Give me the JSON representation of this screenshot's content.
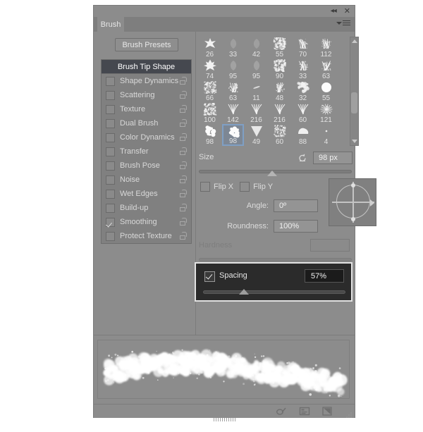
{
  "window": {
    "title": "Brush",
    "collapse_icon": "collapse-left-icon",
    "close_icon": "close-icon",
    "menu_icon": "panel-menu-icon"
  },
  "left_panel": {
    "presets_button": "Brush Presets",
    "header": "Brush Tip Shape",
    "options": [
      {
        "label": "Shape Dynamics",
        "checked": false,
        "lock": true
      },
      {
        "label": "Scattering",
        "checked": false,
        "lock": true
      },
      {
        "label": "Texture",
        "checked": false,
        "lock": true
      },
      {
        "label": "Dual Brush",
        "checked": false,
        "lock": true
      },
      {
        "label": "Color Dynamics",
        "checked": false,
        "lock": true
      },
      {
        "label": "Transfer",
        "checked": false,
        "lock": true
      },
      {
        "label": "Brush Pose",
        "checked": false,
        "lock": true
      },
      {
        "label": "Noise",
        "checked": false,
        "lock": true
      },
      {
        "label": "Wet Edges",
        "checked": false,
        "lock": true
      },
      {
        "label": "Build-up",
        "checked": false,
        "lock": true
      },
      {
        "label": "Smoothing",
        "checked": true,
        "lock": true
      },
      {
        "label": "Protect Texture",
        "checked": false,
        "lock": true
      }
    ]
  },
  "brush_grid": {
    "selected_index": 25,
    "tips": [
      {
        "size": "26",
        "shape": "star"
      },
      {
        "size": "33",
        "shape": "leaf"
      },
      {
        "size": "42",
        "shape": "leaf"
      },
      {
        "size": "55",
        "shape": "scatter"
      },
      {
        "size": "70",
        "shape": "grass"
      },
      {
        "size": "112",
        "shape": "grass"
      },
      {
        "size": "74",
        "shape": "maple"
      },
      {
        "size": "95",
        "shape": "leaf-solid"
      },
      {
        "size": "95",
        "shape": "leaf-solid"
      },
      {
        "size": "90",
        "shape": "scatter"
      },
      {
        "size": "33",
        "shape": "grass"
      },
      {
        "size": "63",
        "shape": "grass"
      },
      {
        "size": "66",
        "shape": "speckle"
      },
      {
        "size": "63",
        "shape": "grass"
      },
      {
        "size": "11",
        "shape": "dash"
      },
      {
        "size": "48",
        "shape": "grass"
      },
      {
        "size": "32",
        "shape": "splat"
      },
      {
        "size": "55",
        "shape": "round"
      },
      {
        "size": "100",
        "shape": "speckle"
      },
      {
        "size": "142",
        "shape": "blades"
      },
      {
        "size": "216",
        "shape": "blades"
      },
      {
        "size": "216",
        "shape": "blades"
      },
      {
        "size": "60",
        "shape": "blades"
      },
      {
        "size": "121",
        "shape": "burst"
      },
      {
        "size": "98",
        "shape": "cloud"
      },
      {
        "size": "98",
        "shape": "cloud"
      },
      {
        "size": "49",
        "shape": "cone"
      },
      {
        "size": "60",
        "shape": "noise"
      },
      {
        "size": "88",
        "shape": "blob"
      },
      {
        "size": "4",
        "shape": "dot"
      }
    ],
    "scrollbar": {
      "up_icon": "scroll-up-arrow-icon",
      "down_icon": "scroll-down-arrow-icon"
    }
  },
  "controls": {
    "size": {
      "label": "Size",
      "value": "98 px",
      "reset_icon": "reset-icon",
      "slider_percent": 46
    },
    "flip_x": {
      "label": "Flip X",
      "checked": false
    },
    "flip_y": {
      "label": "Flip Y",
      "checked": false
    },
    "angle": {
      "label": "Angle:",
      "value": "0º"
    },
    "roundness": {
      "label": "Roundness:",
      "value": "100%"
    },
    "hardness": {
      "label": "Hardness",
      "value": "",
      "disabled": true
    },
    "spacing": {
      "label": "Spacing",
      "value": "57%",
      "checked": true,
      "slider_percent": 32,
      "highlighted": true
    },
    "angle_preview": {
      "name": "angle-roundness-preview"
    }
  },
  "preview": {
    "name": "brush-stroke-preview"
  },
  "footer": {
    "icons": [
      {
        "name": "toggle-brush-settings-icon"
      },
      {
        "name": "brush-presets-panel-icon"
      },
      {
        "name": "new-brush-preset-icon"
      },
      {
        "name": "delete-brush-icon"
      }
    ]
  }
}
